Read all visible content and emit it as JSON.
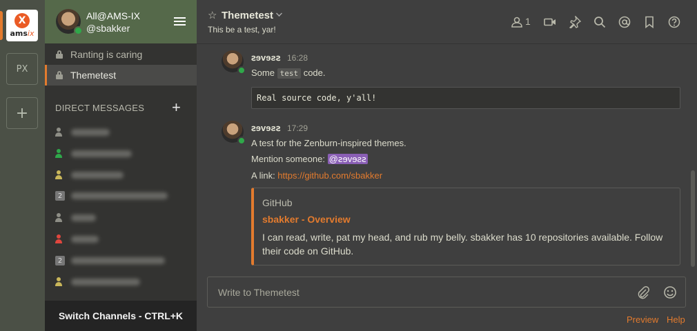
{
  "teams": {
    "active_logo_text": "ams",
    "active_logo_suffix": "ix",
    "items": [
      "PX",
      "+"
    ]
  },
  "sidebar": {
    "team_name": "All@AMS-IX",
    "username": "@sbakker",
    "channels": [
      {
        "label": "Ranting is caring",
        "active": false
      },
      {
        "label": "Themetest",
        "active": true
      }
    ],
    "dm_header": "DIRECT MESSAGES",
    "dm_add": "+",
    "dm_badges": [
      "2",
      "2"
    ],
    "footer": "Switch Channels - CTRL+K"
  },
  "channel": {
    "name": "Themetest",
    "purpose": "This be a test, yar!",
    "member_count": "1"
  },
  "posts": [
    {
      "user": "ꙅɘvɘƨꙅ",
      "time": "16:28",
      "text_before": "Some ",
      "code": "test",
      "text_after": " code.",
      "codeblock": "Real source code, y'all!"
    },
    {
      "user": "ꙅɘvɘƨꙅ",
      "time": "17:29",
      "line1": "A test for the Zenburn-inspired themes.",
      "line2_prefix": "Mention someone: ",
      "mention": "@ꙅɘvɘƨꙅ",
      "line3_prefix": "A link: ",
      "link": "https://github.com/sbakker",
      "embed": {
        "site": "GitHub",
        "title": "sbakker - Overview",
        "description": "I can read, write, pat my head, and rub my belly. sbakker has 10 repositories available. Follow their code on GitHub."
      }
    }
  ],
  "composer": {
    "placeholder": "Write to Themetest",
    "preview": "Preview",
    "help": "Help"
  },
  "colors": {
    "accent": "#e37b2e",
    "sidebar_header": "#55694a",
    "sidebar_bg": "#333331",
    "center_bg": "#3f3f3f",
    "online": "#2fa84a",
    "mention_bg": "#8a5fb5"
  }
}
